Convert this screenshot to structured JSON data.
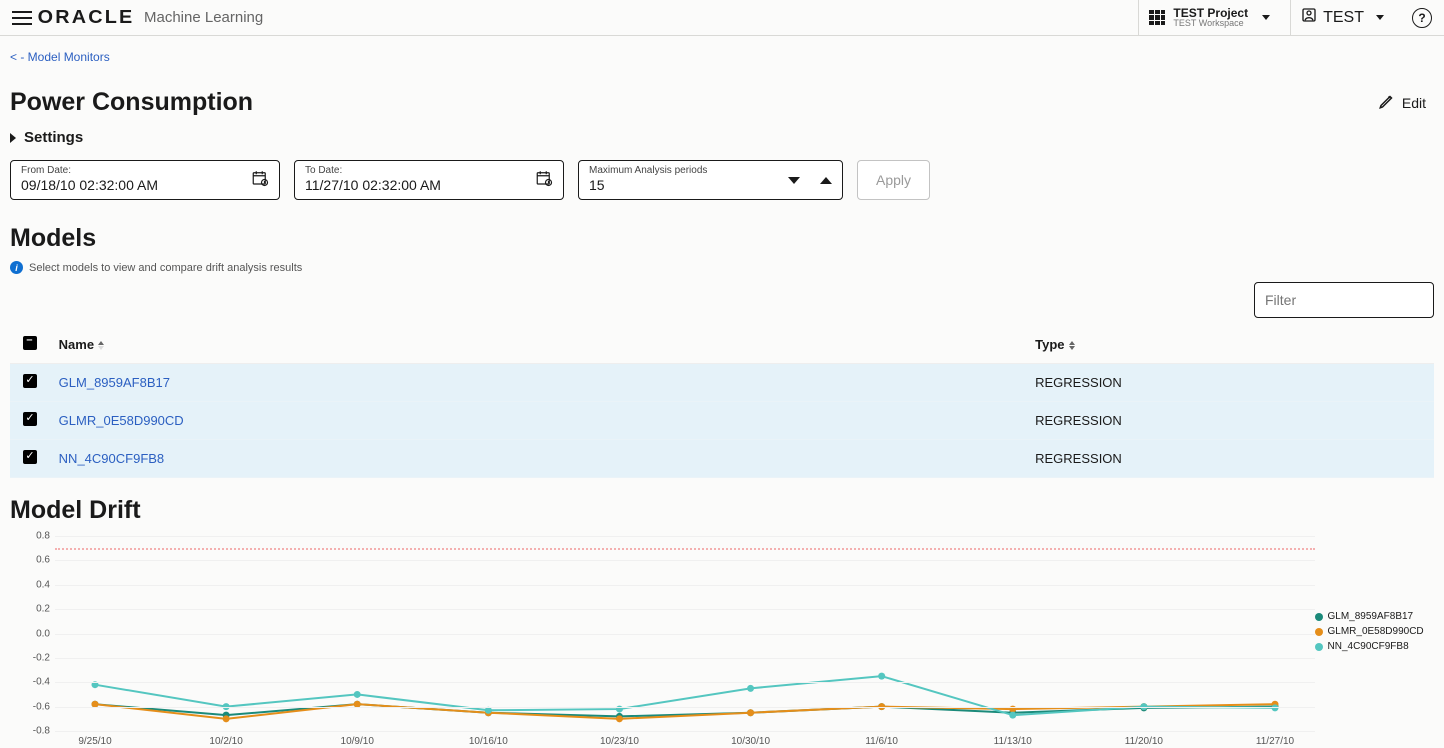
{
  "brand": "ORACLE",
  "brand_sub": "Machine Learning",
  "project": {
    "name": "TEST Project",
    "workspace": "TEST Workspace"
  },
  "user": "TEST",
  "back_link": "< - Model Monitors",
  "page_title": "Power Consumption",
  "edit_label": "Edit",
  "settings_label": "Settings",
  "from_date": {
    "label": "From Date:",
    "value": "09/18/10 02:32:00 AM"
  },
  "to_date": {
    "label": "To Date:",
    "value": "11/27/10 02:32:00 AM"
  },
  "periods": {
    "label": "Maximum Analysis periods",
    "value": "15"
  },
  "apply_label": "Apply",
  "models_heading": "Models",
  "models_hint": "Select models to view and compare drift analysis results",
  "filter_placeholder": "Filter",
  "table": {
    "cols": {
      "name": "Name",
      "type": "Type"
    },
    "rows": [
      {
        "selected": true,
        "name": "GLM_8959AF8B17",
        "type": "REGRESSION"
      },
      {
        "selected": true,
        "name": "GLMR_0E58D990CD",
        "type": "REGRESSION"
      },
      {
        "selected": true,
        "name": "NN_4C90CF9FB8",
        "type": "REGRESSION"
      }
    ]
  },
  "drift_heading": "Model Drift",
  "chart_data": {
    "type": "line",
    "xlabel": "",
    "ylabel": "",
    "categories": [
      "9/25/10",
      "10/2/10",
      "10/9/10",
      "10/16/10",
      "10/23/10",
      "10/30/10",
      "11/6/10",
      "11/13/10",
      "11/20/10",
      "11/27/10"
    ],
    "ylim": [
      -0.8,
      0.8
    ],
    "y_ticks": [
      0.8,
      0.6,
      0.4,
      0.2,
      0.0,
      -0.2,
      -0.4,
      -0.6,
      -0.8
    ],
    "threshold": 0.7,
    "series": [
      {
        "name": "GLM_8959AF8B17",
        "color": "#1b8a7a",
        "values": [
          -0.58,
          -0.67,
          -0.58,
          -0.65,
          -0.68,
          -0.65,
          -0.6,
          -0.65,
          -0.61,
          -0.6
        ]
      },
      {
        "name": "GLMR_0E58D990CD",
        "color": "#e58e1a",
        "values": [
          -0.58,
          -0.7,
          -0.58,
          -0.65,
          -0.7,
          -0.65,
          -0.6,
          -0.62,
          -0.6,
          -0.58
        ]
      },
      {
        "name": "NN_4C90CF9FB8",
        "color": "#54c6c0",
        "values": [
          -0.42,
          -0.6,
          -0.5,
          -0.63,
          -0.62,
          -0.45,
          -0.35,
          -0.67,
          -0.6,
          -0.61
        ]
      }
    ]
  }
}
